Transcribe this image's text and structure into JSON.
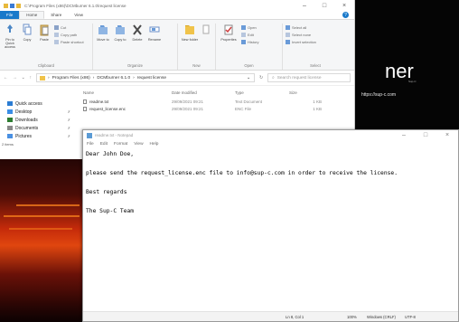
{
  "background_app": {
    "brand": "ner",
    "brand_sub": "Sup-C",
    "url": "https://sup-c.com"
  },
  "explorer": {
    "title": "C:\\Program Files (x86)\\DCMburner 6.1.0\\request license",
    "tabs": [
      "File",
      "Home",
      "Share",
      "View"
    ],
    "ribbon": {
      "clipboard": {
        "label": "Clipboard",
        "pin": "Pin to Quick access",
        "copy": "Copy",
        "paste": "Paste",
        "cut": "Cut",
        "copy_path": "Copy path",
        "paste_shortcut": "Paste shortcut"
      },
      "organize": {
        "label": "Organize",
        "move_to": "Move to",
        "copy_to": "Copy to",
        "delete": "Delete",
        "rename": "Rename"
      },
      "new": {
        "label": "New",
        "new_folder": "New folder"
      },
      "open": {
        "label": "Open",
        "properties": "Properties",
        "open": "Open",
        "edit": "Edit",
        "history": "History"
      },
      "select": {
        "label": "Select",
        "select_all": "Select all",
        "select_none": "Select none",
        "invert": "Invert selection"
      }
    },
    "address": {
      "crumbs": [
        "Program Files (x86)",
        "DCMburner 6.1.0",
        "request license"
      ],
      "search_placeholder": "Search request license"
    },
    "nav": {
      "items": [
        {
          "label": "Quick access",
          "color": "#2b7cd3"
        },
        {
          "label": "Desktop",
          "color": "#3a8ee6"
        },
        {
          "label": "Downloads",
          "color": "#2e7d32"
        },
        {
          "label": "Documents",
          "color": "#8a8a8a"
        },
        {
          "label": "Pictures",
          "color": "#4a90e2"
        }
      ],
      "count": "2 items"
    },
    "columns": {
      "name": "Name",
      "date": "Date modified",
      "type": "Type",
      "size": "Size"
    },
    "files": [
      {
        "name": "readme.txt",
        "date": "29/09/2021 09:21",
        "type": "Text Document",
        "size": "1 KB"
      },
      {
        "name": "request_license.enc",
        "date": "29/09/2021 09:21",
        "type": "ENC File",
        "size": "1 KB"
      }
    ]
  },
  "notepad": {
    "title": "readme.txt - Notepad",
    "menu": [
      "File",
      "Edit",
      "Format",
      "View",
      "Help"
    ],
    "lines": [
      "Dear John Doe,",
      "",
      "please send the request_license.enc file to info@sup-c.com in order to receive the license.",
      "",
      "Best regards",
      "",
      "The Sup-C Team"
    ],
    "status": {
      "position": "Ln 8, Col 1",
      "zoom": "100%",
      "line_ending": "Windows (CRLF)",
      "encoding": "UTF-8"
    }
  }
}
